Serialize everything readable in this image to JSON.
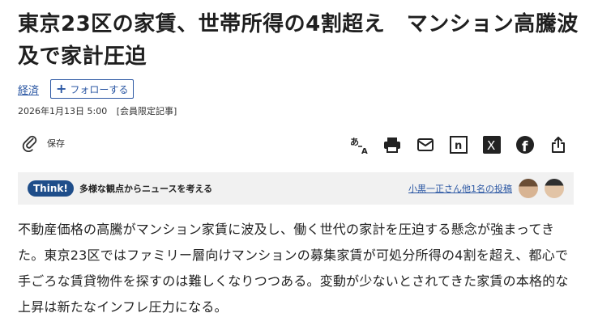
{
  "headline": "東京23区の家賃、世帯所得の4割超え　マンション高騰波及で家計圧迫",
  "topic": {
    "label": "経済",
    "follow_label": "フォローする"
  },
  "meta": {
    "date": "2026年1月13日 5:00",
    "badge": "[会員限定記事]"
  },
  "toolbar": {
    "save_label": "保存",
    "buttons": [
      "translate-icon",
      "print-icon",
      "mail-icon",
      "note-icon",
      "x-icon",
      "facebook-icon",
      "share-icon"
    ],
    "note_letter": "n",
    "x_letter": "X",
    "fb_letter": "f"
  },
  "think": {
    "badge": "Think!",
    "text": "多様な観点からニュースを考える",
    "link": "小黒一正さん他1名の投稿"
  },
  "body": "不動産価格の高騰がマンション家賃に波及し、働く世代の家計を圧迫する懸念が強まってきた。東京23区ではファミリー層向けマンションの募集家賃が可処分所得の4割を超え、都心で手ごろな賃貸物件を探すのは難しくなりつつある。変動が少ないとされてきた家賃の本格的な上昇は新たなインフレ圧力になる。",
  "colors": {
    "link": "#2b57a3",
    "badge_bg": "#1f4e8a",
    "think_bg": "#f1f1f1"
  }
}
